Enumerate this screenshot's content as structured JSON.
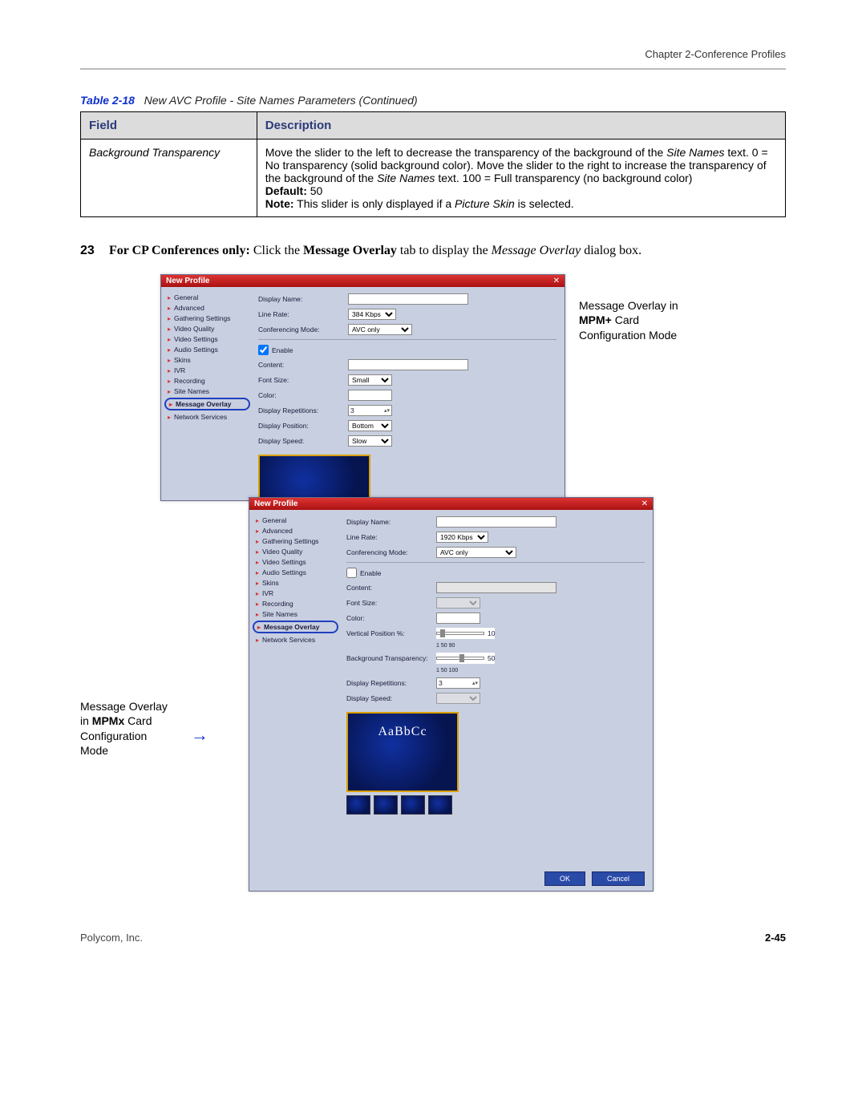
{
  "header": {
    "chapter": "Chapter 2-Conference Profiles"
  },
  "table": {
    "caption_label": "Table 2-18",
    "caption_title": "New AVC Profile - Site Names Parameters (Continued)",
    "col_field": "Field",
    "col_desc": "Description",
    "row_field": "Background Transparency",
    "row_desc_1": "Move the slider to the left to decrease the transparency of the background of the ",
    "row_desc_em1": "Site Names",
    "row_desc_2": " text. 0 = No transparency (solid background color). Move the slider to the right to increase the transparency of the background of the ",
    "row_desc_em2": "Site Names",
    "row_desc_3": " text. 100 = Full transparency (no background color)",
    "default_label": "Default:",
    "default_val": " 50",
    "note_label": "Note:",
    "note_body": " This slider is only displayed if a ",
    "note_em": "Picture Skin",
    "note_tail": " is selected."
  },
  "instruction": {
    "num": "23",
    "p1": "For CP Conferences only:",
    "p2": " Click the ",
    "p3": "Message Overlay",
    "p4": " tab to display the ",
    "p5": "Message Overlay",
    "p6": " dialog box."
  },
  "dialog": {
    "title": "New Profile",
    "nav_a": [
      "General",
      "Advanced",
      "Gathering Settings",
      "Video Quality",
      "Video Settings",
      "Audio Settings",
      "Skins",
      "IVR",
      "Recording",
      "Site Names",
      "Message Overlay",
      "Network Services"
    ],
    "nav_b": [
      "General",
      "Advanced",
      "Gathering Settings",
      "Video Quality",
      "Video Settings",
      "Audio Settings",
      "Skins",
      "IVR",
      "Recording",
      "Site Names",
      "Message Overlay",
      "Network Services"
    ],
    "lbl_display_name": "Display Name:",
    "lbl_line_rate": "Line Rate:",
    "val_line_rate_a": "384 Kbps",
    "val_line_rate_b": "1920 Kbps",
    "lbl_conf_mode": "Conferencing Mode:",
    "val_conf_mode": "AVC only",
    "lbl_enable": "Enable",
    "lbl_content": "Content:",
    "lbl_font_size": "Font Size:",
    "val_font_size": "Small",
    "lbl_color": "Color:",
    "val_color": "AaBbCc",
    "lbl_disp_rep": "Display Repetitions:",
    "val_disp_rep": "3",
    "lbl_disp_pos": "Display Position:",
    "val_disp_pos": "Bottom",
    "lbl_disp_speed": "Display Speed:",
    "val_disp_speed": "Slow",
    "lbl_vpos": "Vertical Position %:",
    "val_vpos_ticks": "1     50     90",
    "val_vpos": "10",
    "lbl_bg_trans": "Background Transparency:",
    "val_bg_trans_ticks": "1    50   100",
    "val_bg_trans": "50",
    "btn_ok": "OK",
    "btn_cancel": "Cancel",
    "preview_text": "AaBbCc"
  },
  "callouts": {
    "a1": "Message Overlay in ",
    "a_bold": "MPM+",
    "a2": " Card Configuration Mode",
    "b1": "Message Overlay in ",
    "b_bold": "MPMx",
    "b2": " Card Configuration Mode"
  },
  "footer": {
    "left": "Polycom, Inc.",
    "right": "2-45"
  }
}
